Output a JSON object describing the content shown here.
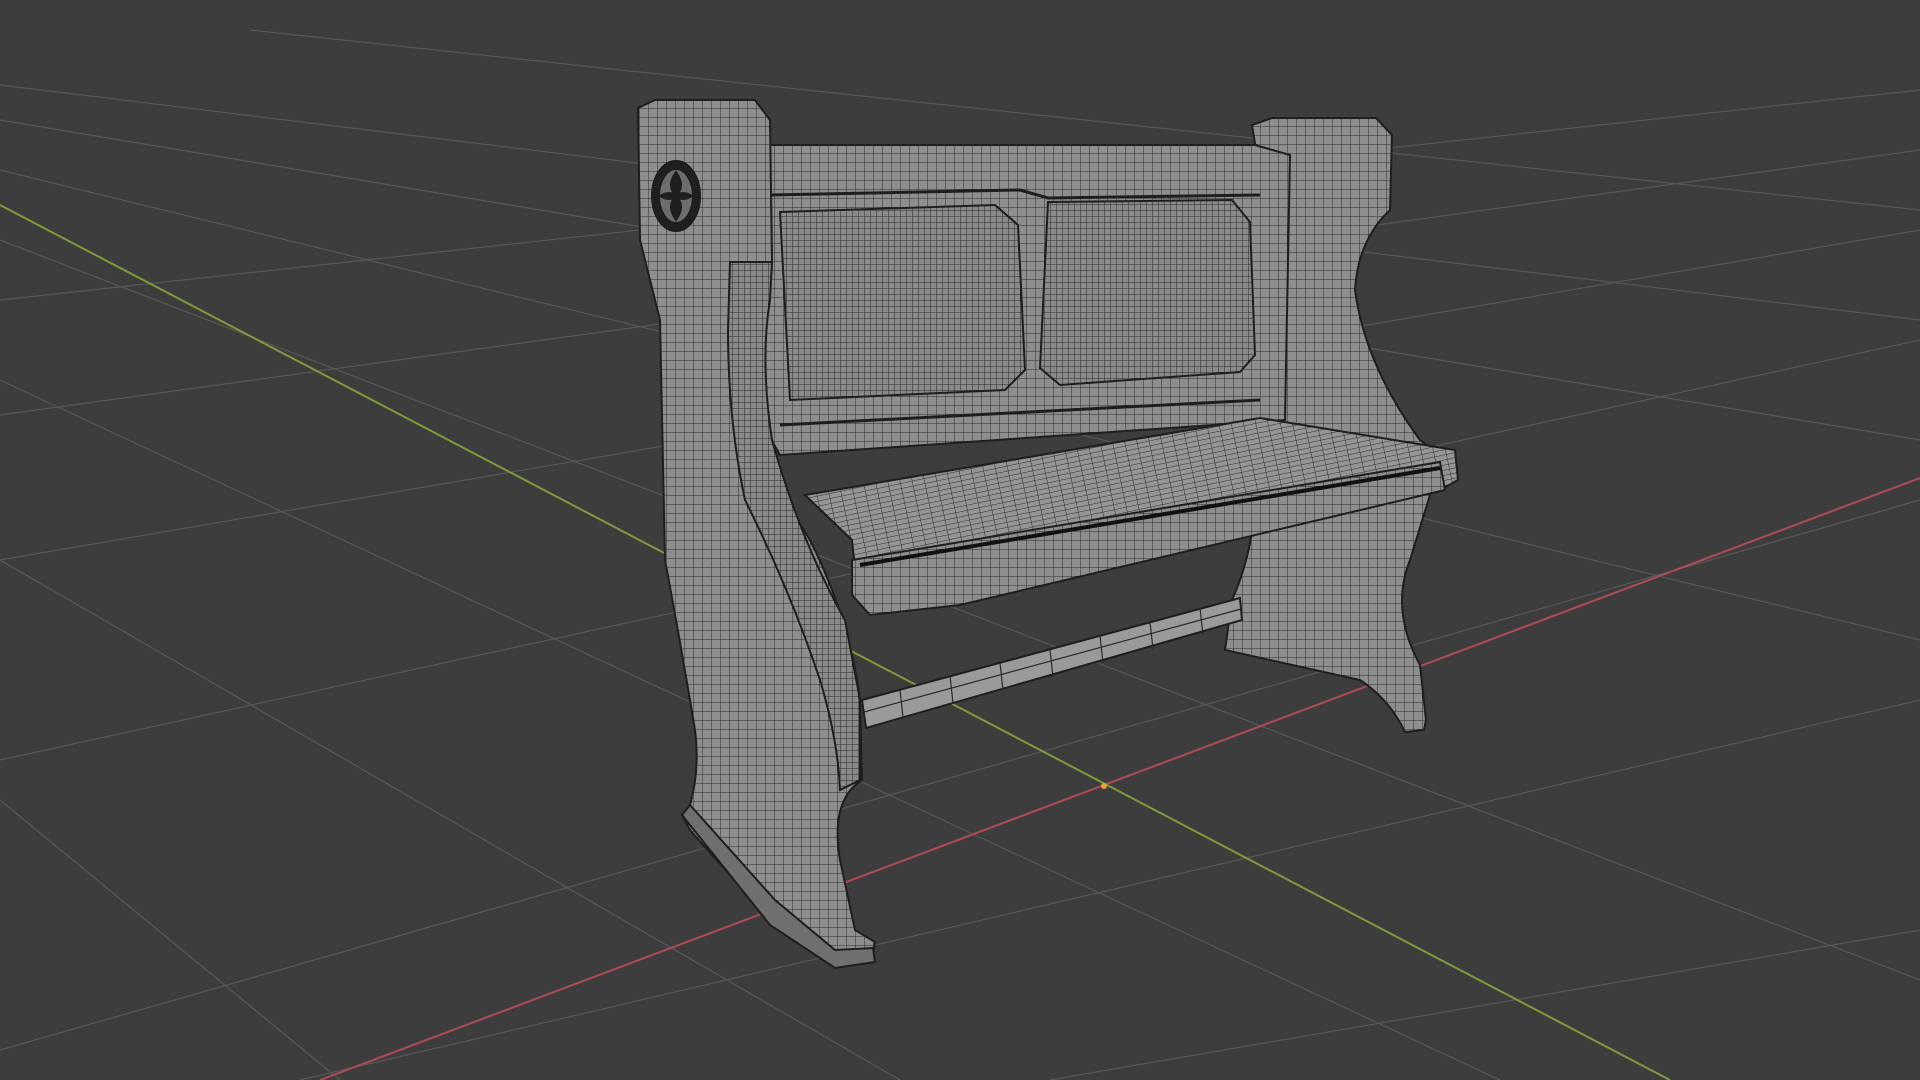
{
  "viewport": {
    "background": "#3d3d3d",
    "grid_color": "#5a5a5a",
    "x_axis_color": "#b04a55",
    "y_axis_color": "#7f9a3a",
    "origin_color": "#e8a23a"
  },
  "model": {
    "name_icon": "church-pew-wireframe",
    "fill_color": "#8f8f8f",
    "wire_color": "#2a2a2a",
    "emblem": "quatrefoil-emblem-icon"
  }
}
